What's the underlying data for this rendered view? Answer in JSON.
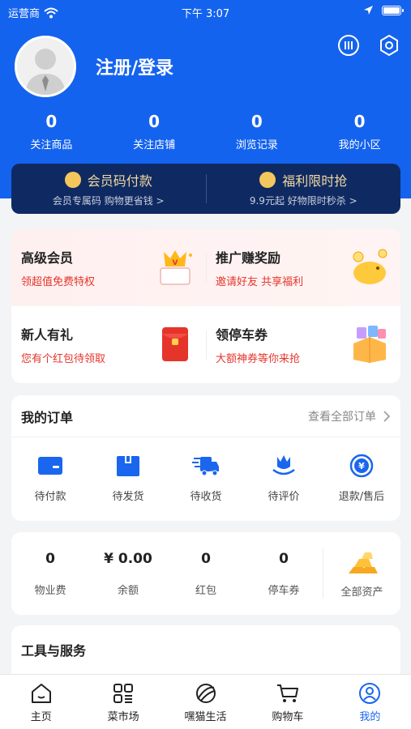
{
  "status_bar": {
    "carrier": "运营商",
    "time": "下午 3:07"
  },
  "profile": {
    "login_label": "注册/登录"
  },
  "stats": [
    {
      "value": "0",
      "label": "关注商品"
    },
    {
      "value": "0",
      "label": "关注店铺"
    },
    {
      "value": "0",
      "label": "浏览记录"
    },
    {
      "value": "0",
      "label": "我的小区"
    }
  ],
  "banner": {
    "left": {
      "title": "会员码付款",
      "subtitle": "会员专属码 购物更省钱 >"
    },
    "right": {
      "title": "福利限时抢",
      "subtitle": "9.9元起 好物限时秒杀 >"
    }
  },
  "promo": [
    {
      "title": "高级会员",
      "subtitle": "领超值免费特权"
    },
    {
      "title": "推广赚奖励",
      "subtitle": "邀请好友 共享福利"
    },
    {
      "title": "新人有礼",
      "subtitle": "您有个红包待领取"
    },
    {
      "title": "领停车券",
      "subtitle": "大额神券等你来抢"
    }
  ],
  "orders": {
    "title": "我的订单",
    "view_all": "查看全部订单",
    "items": [
      {
        "label": "待付款",
        "icon": "wallet-icon"
      },
      {
        "label": "待发货",
        "icon": "package-icon"
      },
      {
        "label": "待收货",
        "icon": "truck-icon"
      },
      {
        "label": "待评价",
        "icon": "flower-icon"
      },
      {
        "label": "退款/售后",
        "icon": "refund-icon"
      }
    ]
  },
  "assets": {
    "items": [
      {
        "value": "0",
        "label": "物业费"
      },
      {
        "value": "¥ 0.00",
        "label": "余额"
      },
      {
        "value": "0",
        "label": "红包"
      },
      {
        "value": "0",
        "label": "停车券"
      }
    ],
    "total_label": "全部资产"
  },
  "tools": {
    "title": "工具与服务"
  },
  "tabbar": [
    {
      "label": "主页",
      "icon": "home-icon"
    },
    {
      "label": "菜市场",
      "icon": "grid-icon"
    },
    {
      "label": "嘿猫生活",
      "icon": "planet-icon"
    },
    {
      "label": "购物车",
      "icon": "cart-icon"
    },
    {
      "label": "我的",
      "icon": "user-icon",
      "active": true
    }
  ],
  "colors": {
    "brand_blue": "#1463ef",
    "banner_navy": "#0f2a63",
    "accent_red": "#e5352b",
    "gold": "#f2d9a0"
  }
}
